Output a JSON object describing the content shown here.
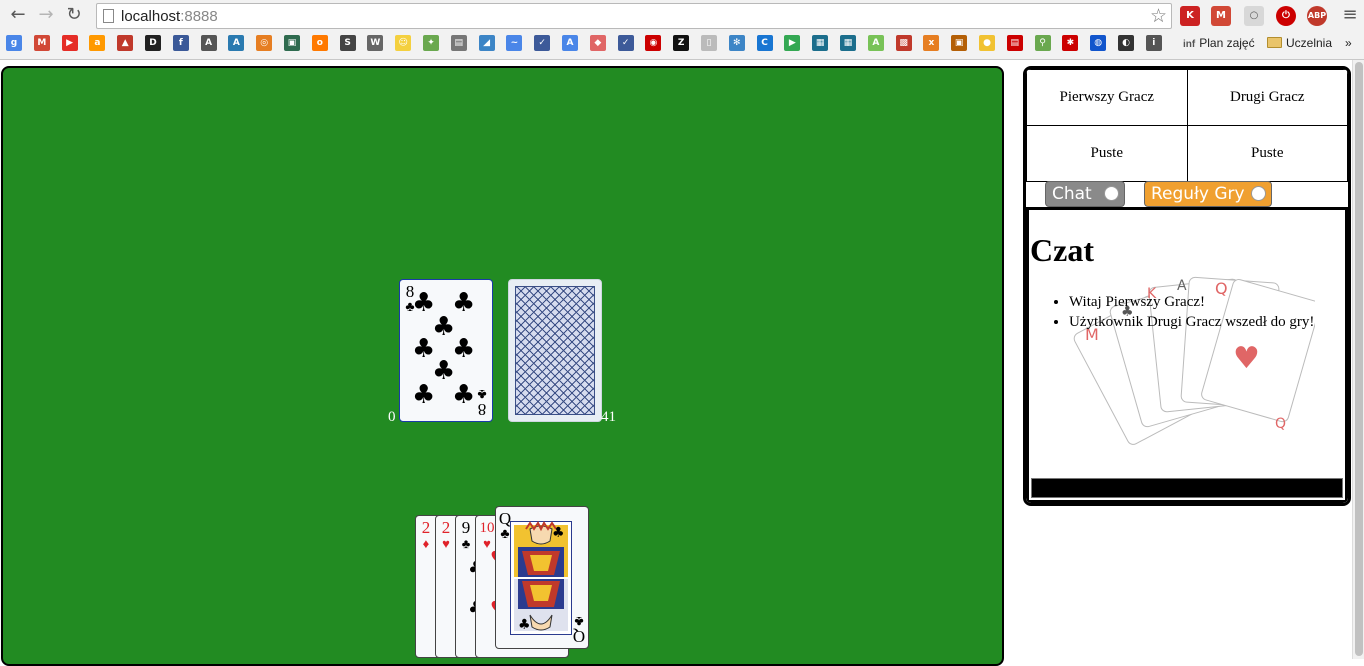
{
  "browser": {
    "url_host": "localhost",
    "url_port": ":8888",
    "bookmarks": [
      {
        "icon": "google-plus-icon",
        "color": "#4a86e8",
        "glyph": "g"
      },
      {
        "icon": "gmail-icon",
        "color": "#d14836",
        "glyph": "M"
      },
      {
        "icon": "youtube-icon",
        "color": "#e52d27",
        "glyph": "▶"
      },
      {
        "icon": "amazon-icon",
        "color": "#f90",
        "glyph": "a"
      },
      {
        "icon": "bookmark-red-icon",
        "color": "#c0392b",
        "glyph": "▲"
      },
      {
        "icon": "bookmark-dark-icon",
        "color": "#222",
        "glyph": "D"
      },
      {
        "icon": "facebook-icon",
        "color": "#3b5998",
        "glyph": "f"
      },
      {
        "icon": "bookmark-als-icon",
        "color": "#555",
        "glyph": "A"
      },
      {
        "icon": "bookmark-a3-icon",
        "color": "#2a7ab0",
        "glyph": "A"
      },
      {
        "icon": "bookmark-orange-icon",
        "color": "#e67e22",
        "glyph": "◎"
      },
      {
        "icon": "bookmark-green-icon",
        "color": "#2f6b4f",
        "glyph": "▣"
      },
      {
        "icon": "orange-icon",
        "color": "#ff7900",
        "glyph": "o"
      },
      {
        "icon": "bookmark-s-icon",
        "color": "#444",
        "glyph": "S"
      },
      {
        "icon": "wikipedia-icon",
        "color": "#666",
        "glyph": "W"
      },
      {
        "icon": "smiley-icon",
        "color": "#f4d03f",
        "glyph": "☺"
      },
      {
        "icon": "maps-icon",
        "color": "#6aa84f",
        "glyph": "✦"
      },
      {
        "icon": "bookmark-image-icon",
        "color": "#777",
        "glyph": "▤"
      },
      {
        "icon": "bookmark-blue-icon",
        "color": "#3d85c6",
        "glyph": "◢"
      },
      {
        "icon": "bookmark-wave-icon",
        "color": "#4a86e8",
        "glyph": "~"
      },
      {
        "icon": "bookmark-check-icon",
        "color": "#3d5a99",
        "glyph": "✓"
      },
      {
        "icon": "translate-icon",
        "color": "#4a86e8",
        "glyph": "A"
      },
      {
        "icon": "bookmark-diamond-icon",
        "color": "#e06666",
        "glyph": "◆"
      },
      {
        "icon": "bookmark-check2-icon",
        "color": "#3d5a99",
        "glyph": "✓"
      },
      {
        "icon": "bookmark-target-icon",
        "color": "#cc0000",
        "glyph": "◉"
      },
      {
        "icon": "bookmark-z-icon",
        "color": "#111",
        "glyph": "Z"
      },
      {
        "icon": "bookmark-page-icon",
        "color": "#bbb",
        "glyph": "▯"
      },
      {
        "icon": "bookmark-people-icon",
        "color": "#3d85c6",
        "glyph": "✻"
      },
      {
        "icon": "bookmark-c-icon",
        "color": "#1976d2",
        "glyph": "C"
      },
      {
        "icon": "play-store-icon",
        "color": "#34a853",
        "glyph": "▶"
      },
      {
        "icon": "bookmark-teal-icon",
        "color": "#1c6e8c",
        "glyph": "▦"
      },
      {
        "icon": "bookmark-teal2-icon",
        "color": "#1c6e8c",
        "glyph": "▦"
      },
      {
        "icon": "android-icon",
        "color": "#78c257",
        "glyph": "A"
      },
      {
        "icon": "bookmark-grid-icon",
        "color": "#c0392b",
        "glyph": "▩"
      },
      {
        "icon": "xda-icon",
        "color": "#e67e22",
        "glyph": "x"
      },
      {
        "icon": "bookmark-dark-orange-icon",
        "color": "#b45f06",
        "glyph": "▣"
      },
      {
        "icon": "bookmark-circle-icon",
        "color": "#f1c232",
        "glyph": "●"
      },
      {
        "icon": "bookmark-red2-icon",
        "color": "#cc0000",
        "glyph": "▤"
      },
      {
        "icon": "bookmark-bird-icon",
        "color": "#6aa84f",
        "glyph": "⚲"
      },
      {
        "icon": "bookmark-red3-icon",
        "color": "#cc0000",
        "glyph": "✱"
      },
      {
        "icon": "bookmark-blue2-icon",
        "color": "#1155cc",
        "glyph": "◍"
      },
      {
        "icon": "github-icon",
        "color": "#333",
        "glyph": "◐"
      },
      {
        "icon": "bookmark-inf-icon",
        "color": "#555",
        "glyph": "i"
      }
    ],
    "bookmark_plan": "Plan zajęć",
    "bookmark_folder": "Uczelnia",
    "more": "»"
  },
  "game": {
    "discard_card": {
      "rank": "8",
      "suit": "♣"
    },
    "discard_count": "0",
    "deck_count": "41",
    "hand": [
      {
        "rank": "2",
        "suit": "♦",
        "color": "red"
      },
      {
        "rank": "2",
        "suit": "♥",
        "color": "red"
      },
      {
        "rank": "9",
        "suit": "♣",
        "color": "blk"
      },
      {
        "rank": "10",
        "suit": "♥",
        "color": "red"
      },
      {
        "rank": "Q",
        "suit": "♣",
        "color": "blk"
      }
    ]
  },
  "sidebar": {
    "players": {
      "first_name": "Pierwszy Gracz",
      "second_name": "Drugi Gracz",
      "first_status": "Puste",
      "second_status": "Puste"
    },
    "tabs": {
      "chat_label": "Chat",
      "rules_label": "Reguły Gry",
      "chat_color": "#8a8a8a",
      "rules_color": "#f0a030"
    },
    "chat": {
      "title": "Czat",
      "messages": [
        "Witaj Pierwszy Gracz!",
        "Użytkownik Drugi Gracz wszedł do gry!"
      ]
    }
  }
}
